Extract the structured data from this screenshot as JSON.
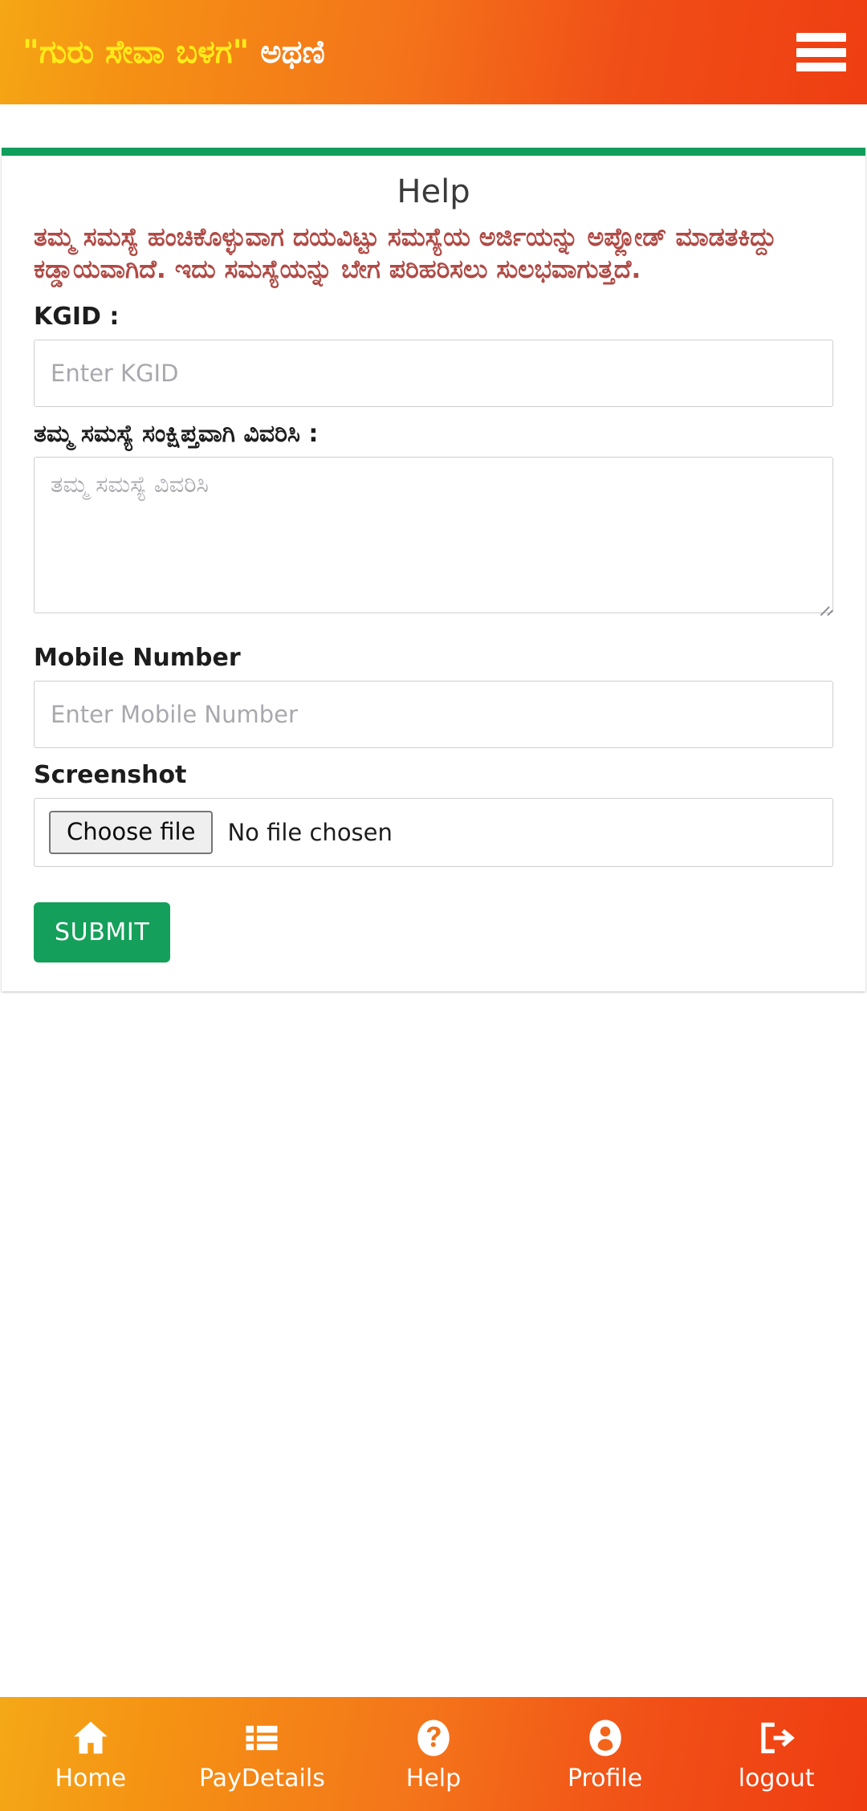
{
  "header": {
    "title_quoted": "\"ಗುರು ಸೇವಾ ಬಳಗ\"",
    "title_plain": " ಅಥಣಿ",
    "menu_icon": "hamburger-menu-icon",
    "gradient_start": "#f5a714",
    "gradient_end": "#ef3e12"
  },
  "card": {
    "accent_color": "#109e5c",
    "title": "Help",
    "notice": "ತಮ್ಮ ಸಮಸ್ಯೆ ಹಂಚಿಕೊಳ್ಳುವಾಗ ದಯವಿಟ್ಟು ಸಮಸ್ಯೆಯ ಅರ್ಜಿಯನ್ನು ಅಪ್ಲೋಡ್ ಮಾಡತಕಿದ್ದು ಕಡ್ಡಾಯವಾಗಿದೆ. ಇದು ಸಮಸ್ಯೆಯನ್ನು ಬೇಗ ಪರಿಹರಿಸಲು ಸುಲಭವಾಗುತ್ತದೆ.",
    "notice_color": "#b04a45"
  },
  "form": {
    "kgid": {
      "label": "KGID :",
      "placeholder": "Enter KGID",
      "value": ""
    },
    "problem": {
      "label": "ತಮ್ಮ ಸಮಸ್ಯೆ ಸಂಕ್ಷಿಪ್ತವಾಗಿ ವಿವರಿಸಿ :",
      "placeholder": "ತಮ್ಮ ಸಮಸ್ಯೆ ವಿವರಿಸಿ",
      "value": ""
    },
    "mobile": {
      "label": "Mobile Number",
      "placeholder": "Enter Mobile Number",
      "value": ""
    },
    "screenshot": {
      "label": "Screenshot",
      "button_label": "Choose file",
      "status": "No file chosen"
    },
    "submit_label": "SUBMIT",
    "submit_color": "#14a05a"
  },
  "bottomnav": {
    "items": [
      {
        "label": "Home",
        "icon": "home-icon"
      },
      {
        "label": "PayDetails",
        "icon": "list-icon"
      },
      {
        "label": "Help",
        "icon": "question-circle-icon"
      },
      {
        "label": "Profile",
        "icon": "user-circle-icon"
      },
      {
        "label": "logout",
        "icon": "logout-icon"
      }
    ]
  }
}
